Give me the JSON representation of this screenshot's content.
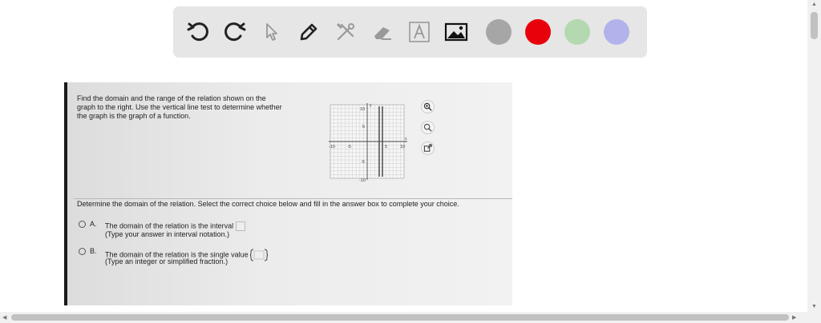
{
  "toolbar": {
    "tools": [
      {
        "name": "undo-icon"
      },
      {
        "name": "redo-icon"
      },
      {
        "name": "pointer-icon"
      },
      {
        "name": "pen-icon"
      },
      {
        "name": "tools-icon"
      },
      {
        "name": "eraser-icon"
      },
      {
        "name": "text-icon"
      },
      {
        "name": "image-icon"
      }
    ],
    "colors": [
      "#a6a6a6",
      "#e8000b",
      "#b4d8b0",
      "#b3b3ec"
    ]
  },
  "question": {
    "text_lines": [
      "Find the domain and the range of the relation shown on the",
      "graph to the right. Use the vertical line test to determine whether",
      "the graph is the graph of a function."
    ],
    "prompt": "Determine the domain of the relation. Select the correct choice below and fill in the answer box to complete your choice.",
    "choice_a": {
      "letter": "A.",
      "line1": "The domain of the relation is the interval",
      "line2": "(Type your answer in interval notation.)"
    },
    "choice_b": {
      "letter": "B.",
      "line1": "The domain of the relation is the single value",
      "line2": "(Type an integer or simplified fraction.)"
    }
  },
  "graph": {
    "y_label": "y",
    "x_label": "x",
    "ticks": {
      "y_top": "10",
      "y_5": "5",
      "y_neg5": "-5",
      "y_bottom": "-10",
      "x_left": "-10",
      "x_neg5": "-5",
      "x_5": "5",
      "x_right": "10"
    }
  }
}
